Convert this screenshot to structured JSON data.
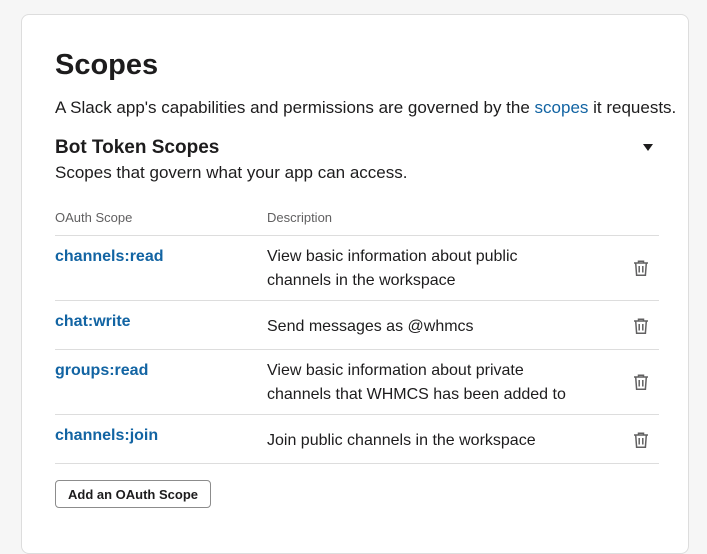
{
  "page": {
    "title": "Scopes",
    "intro_before": "A Slack app's capabilities and permissions are governed by the ",
    "intro_link": "scopes",
    "intro_after": " it requests."
  },
  "section": {
    "title": "Bot Token Scopes",
    "subtitle": "Scopes that govern what your app can access.",
    "toggle_icon": "caret-down-icon"
  },
  "table": {
    "headers": {
      "scope": "OAuth Scope",
      "description": "Description"
    },
    "rows": [
      {
        "scope": "channels:read",
        "description": "View basic information about public channels in the workspace"
      },
      {
        "scope": "chat:write",
        "description": "Send messages as @whmcs"
      },
      {
        "scope": "groups:read",
        "description": "View basic information about private channels that WHMCS has been added to"
      },
      {
        "scope": "channels:join",
        "description": "Join public channels in the workspace"
      }
    ],
    "row_action_icon": "trash-icon"
  },
  "actions": {
    "add_scope_label": "Add an OAuth Scope"
  },
  "colors": {
    "link": "#1264a3",
    "text": "#1d1c1d",
    "muted": "#616061",
    "divider": "#dddddd"
  }
}
